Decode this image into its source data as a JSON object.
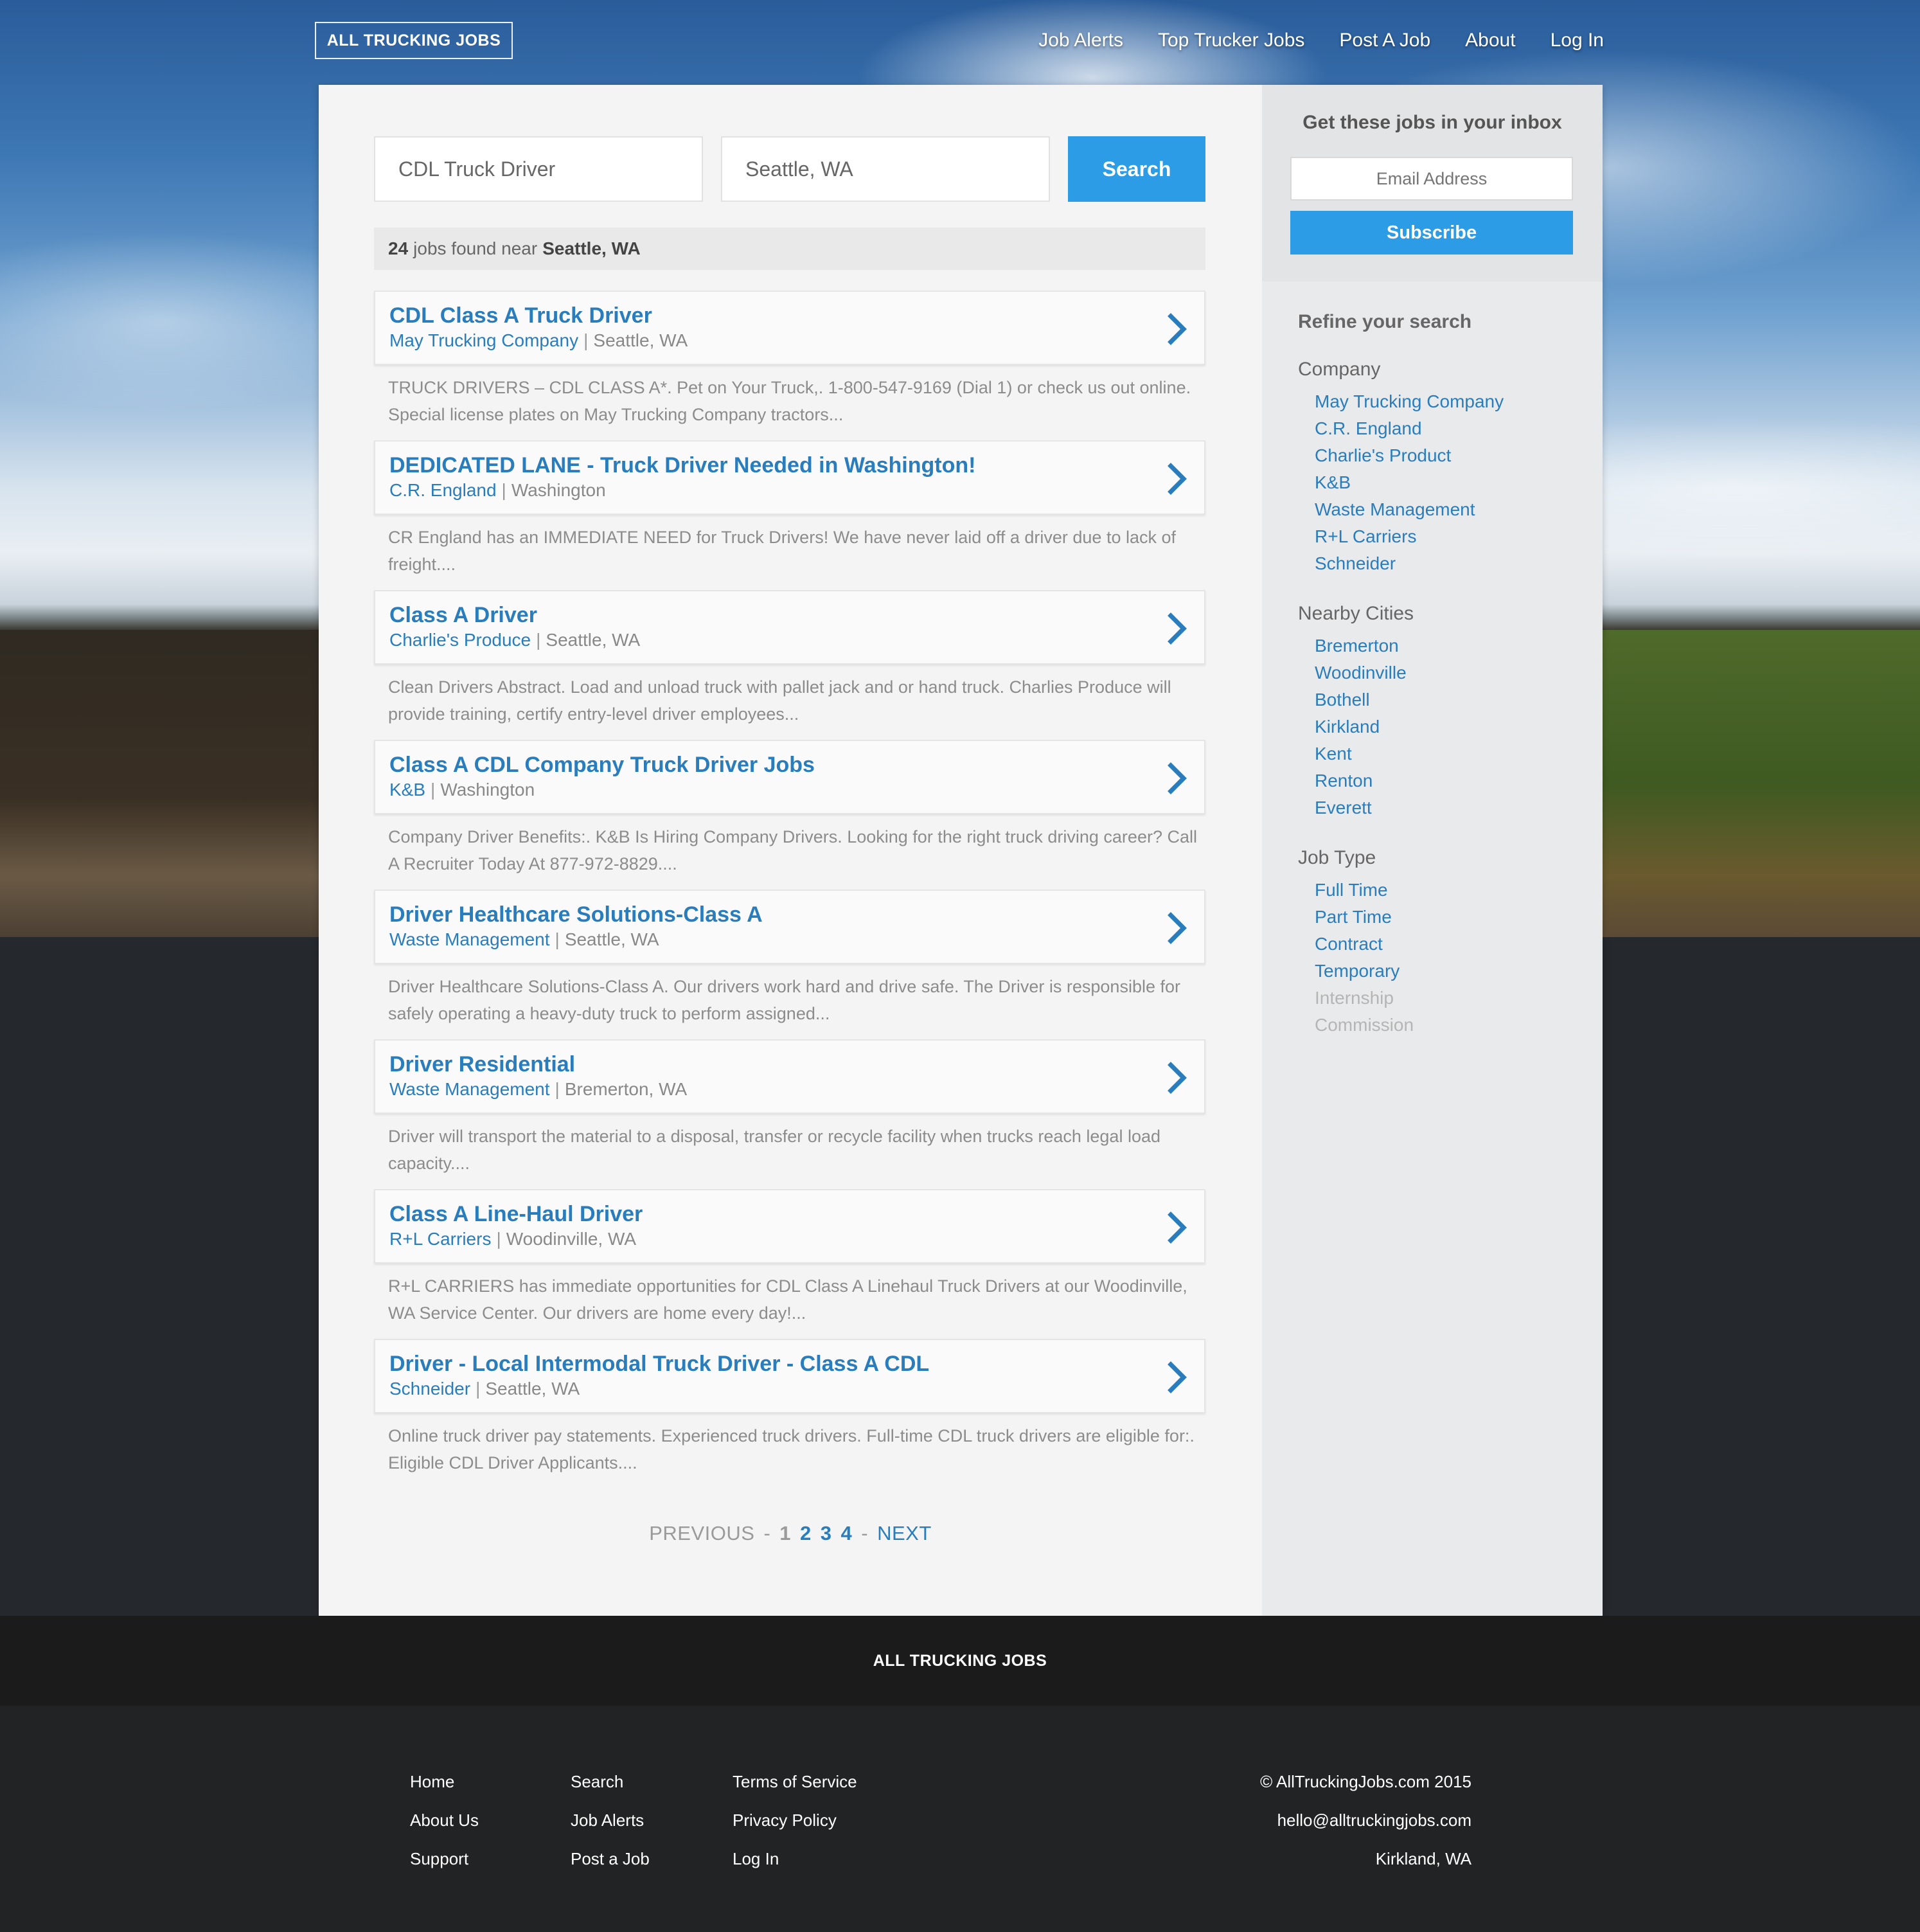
{
  "header": {
    "logo": "ALL TRUCKING JOBS",
    "nav": [
      "Job Alerts",
      "Top Trucker Jobs",
      "Post A Job",
      "About",
      "Log In"
    ]
  },
  "search": {
    "what_value": "CDL Truck Driver",
    "where_value": "Seattle, WA",
    "button_label": "Search"
  },
  "results": {
    "count": "24",
    "text": "jobs found near",
    "location": "Seattle, WA"
  },
  "jobs": [
    {
      "title": "CDL Class A Truck Driver",
      "company": "May Trucking Company",
      "location": "Seattle, WA",
      "description": "TRUCK DRIVERS – CDL CLASS A*. Pet on Your Truck,. 1-800-547-9169 (Dial 1) or check us out online. Special license plates on May Trucking Company tractors..."
    },
    {
      "title": "DEDICATED LANE - Truck Driver Needed in Washington!",
      "company": "C.R. England",
      "location": "Washington",
      "description": "CR England has an IMMEDIATE NEED for Truck Drivers! We have never laid off a driver due to lack of freight...."
    },
    {
      "title": "Class A Driver",
      "company": "Charlie's Produce",
      "location": "Seattle, WA",
      "description": "Clean Drivers Abstract. Load and unload truck with pallet jack and or hand truck. Charlies Produce will provide training, certify entry-level driver employees..."
    },
    {
      "title": "Class A CDL Company Truck Driver Jobs",
      "company": "K&B",
      "location": "Washington",
      "description": "Company Driver Benefits:. K&B Is Hiring Company Drivers. Looking for the right truck driving career? Call A Recruiter Today At 877-972-8829...."
    },
    {
      "title": "Driver Healthcare Solutions-Class A",
      "company": "Waste Management",
      "location": "Seattle, WA",
      "description": "Driver Healthcare Solutions-Class A. Our drivers work hard and drive safe. The Driver is responsible for safely operating a heavy-duty truck to perform assigned..."
    },
    {
      "title": "Driver Residential",
      "company": "Waste Management",
      "location": "Bremerton, WA",
      "description": "Driver will transport the material to a disposal, transfer or recycle facility when trucks reach legal load capacity...."
    },
    {
      "title": "Class A Line-Haul Driver",
      "company": "R+L Carriers",
      "location": "Woodinville, WA",
      "description": "R+L CARRIERS has immediate opportunities for CDL Class A Linehaul Truck Drivers at our Woodinville, WA Service Center. Our drivers are home every day!..."
    },
    {
      "title": "Driver - Local Intermodal Truck Driver - Class A CDL",
      "company": "Schneider",
      "location": "Seattle, WA",
      "description": "Online truck driver pay statements. Experienced truck drivers. Full-time CDL truck drivers are eligible for:. Eligible CDL Driver Applicants...."
    }
  ],
  "pagination": {
    "prev": "PREVIOUS",
    "next": "NEXT",
    "sep": "-",
    "pages": [
      "1",
      "2",
      "3",
      "4"
    ],
    "current": "1"
  },
  "sidebar": {
    "subscribe_title": "Get these jobs in your inbox",
    "email_placeholder": "Email Address",
    "subscribe_button": "Subscribe",
    "refine_title": "Refine your search",
    "filters": [
      {
        "heading": "Company",
        "items": [
          {
            "label": "May Trucking Company",
            "enabled": true
          },
          {
            "label": "C.R. England",
            "enabled": true
          },
          {
            "label": "Charlie's Product",
            "enabled": true
          },
          {
            "label": "K&B",
            "enabled": true
          },
          {
            "label": "Waste Management",
            "enabled": true
          },
          {
            "label": "R+L Carriers",
            "enabled": true
          },
          {
            "label": "Schneider",
            "enabled": true
          }
        ]
      },
      {
        "heading": "Nearby Cities",
        "items": [
          {
            "label": "Bremerton",
            "enabled": true
          },
          {
            "label": "Woodinville",
            "enabled": true
          },
          {
            "label": "Bothell",
            "enabled": true
          },
          {
            "label": "Kirkland",
            "enabled": true
          },
          {
            "label": "Kent",
            "enabled": true
          },
          {
            "label": "Renton",
            "enabled": true
          },
          {
            "label": "Everett",
            "enabled": true
          }
        ]
      },
      {
        "heading": "Job Type",
        "items": [
          {
            "label": "Full Time",
            "enabled": true
          },
          {
            "label": "Part Time",
            "enabled": true
          },
          {
            "label": "Contract",
            "enabled": true
          },
          {
            "label": "Temporary",
            "enabled": true
          },
          {
            "label": "Internship",
            "enabled": false
          },
          {
            "label": "Commission",
            "enabled": false
          }
        ]
      }
    ]
  },
  "footer": {
    "brand": "ALL TRUCKING JOBS",
    "columns": [
      [
        "Home",
        "About Us",
        "Support"
      ],
      [
        "Search",
        "Job Alerts",
        "Post a Job"
      ],
      [
        "Terms of Service",
        "Privacy Policy",
        "Log In"
      ]
    ],
    "copyright": "© AllTruckingJobs.com 2015",
    "email": "hello@alltruckingjobs.com",
    "location": "Kirkland, WA"
  },
  "colors": {
    "accent": "#2c9ce6",
    "link": "#2a7dbd",
    "footer_bg": "#222325"
  },
  "icons": {
    "job_chevron": "chevron-right-icon"
  }
}
